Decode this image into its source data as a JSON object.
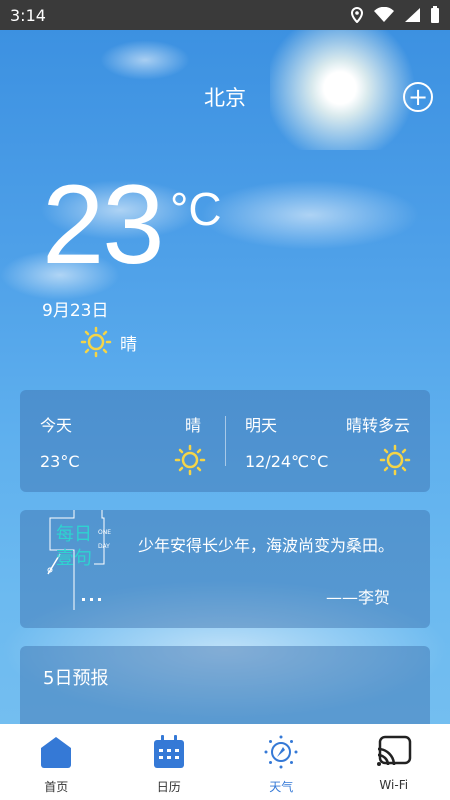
{
  "status_bar": {
    "time": "3:14"
  },
  "header": {
    "city": "北京",
    "add_symbol": "+"
  },
  "current": {
    "temperature": "23",
    "unit": "°C",
    "date": "9月23日",
    "condition": "晴"
  },
  "today_card": {
    "today_label": "今天",
    "today_condition": "晴",
    "today_temp": "23°C",
    "tomorrow_label": "明天",
    "tomorrow_condition": "晴转多云",
    "tomorrow_temp": "12/24℃°C"
  },
  "quote_card": {
    "badge_line1": "每日",
    "badge_line2": "壹句",
    "badge_small1": "ONE",
    "badge_small2": "DAY",
    "text": "少年安得长少年，海波尚变为桑田。",
    "author": "——李贺"
  },
  "forecast": {
    "title": "5日预报"
  },
  "tabs": [
    {
      "label": "首页",
      "icon": "home-icon"
    },
    {
      "label": "日历",
      "icon": "calendar-icon"
    },
    {
      "label": "天气",
      "icon": "weather-icon"
    },
    {
      "label": "Wi-Fi",
      "icon": "cast-icon"
    }
  ],
  "colors": {
    "accent": "#3579d6",
    "sun_icon": "#f5d547"
  }
}
